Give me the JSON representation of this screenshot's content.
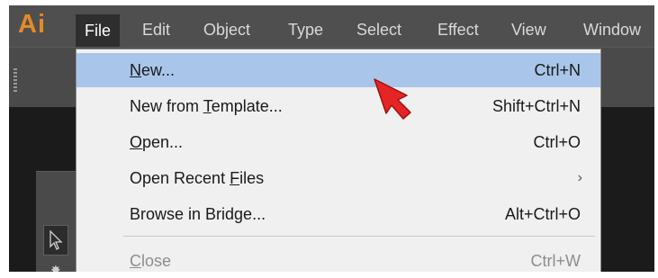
{
  "app": {
    "logo_text": "Ai",
    "logo_color": "#e48a26"
  },
  "menubar": {
    "items": [
      {
        "label": "File",
        "active": true
      },
      {
        "label": "Edit"
      },
      {
        "label": "Object"
      },
      {
        "label": "Type"
      },
      {
        "label": "Select"
      },
      {
        "label": "Effect"
      },
      {
        "label": "View"
      },
      {
        "label": "Window"
      }
    ]
  },
  "file_menu": {
    "highlight_color": "#a9c6ea",
    "items": [
      {
        "label": "New...",
        "mnemonic": "N",
        "shortcut": "Ctrl+N",
        "highlighted": true
      },
      {
        "label": "New from Template...",
        "mnemonic": "T",
        "shortcut": "Shift+Ctrl+N"
      },
      {
        "label": "Open...",
        "mnemonic": "O",
        "shortcut": "Ctrl+O"
      },
      {
        "label": "Open Recent Files",
        "mnemonic": "F",
        "submenu_arrow": "›"
      },
      {
        "label": "Browse in Bridge...",
        "shortcut": "Alt+Ctrl+O"
      },
      {
        "label": "Close",
        "mnemonic": "C",
        "shortcut": "Ctrl+W",
        "disabled": true
      }
    ]
  },
  "pointer": {
    "icon": "red-arrow-cursor-icon",
    "color": "#e52525"
  }
}
